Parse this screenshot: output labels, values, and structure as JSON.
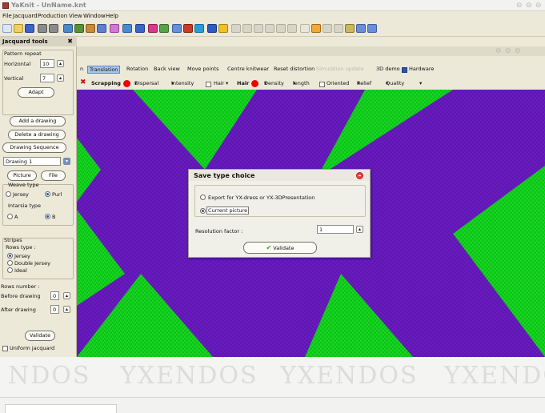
{
  "window": {
    "title": "YaKnit - UnName.knt"
  },
  "menu": [
    "File",
    "Jacquard",
    "Production",
    "View",
    "Window",
    "Help"
  ],
  "left_panel": {
    "title": "Jacquard tools",
    "pattern_repeat": {
      "label": "Pattern repeat",
      "horizontal_label": "Horizontal",
      "horizontal_value": "10",
      "vertical_label": "Vertical",
      "vertical_value": "7"
    },
    "adapt_label": "Adapt",
    "add_drawing_label": "Add a drawing",
    "delete_drawing_label": "Delete a drawing",
    "drawing_sequence_label": "Drawing Sequence",
    "drawing_select": "Drawing 1",
    "picture_label": "Picture",
    "file_label": "File",
    "weave_type": {
      "label": "Weave type",
      "options": [
        "Jersey",
        "Purl"
      ],
      "selected": 1
    },
    "intarsia_type": {
      "label": "Intarsia type",
      "options": [
        "A",
        "B"
      ],
      "selected": 1
    },
    "stripes": {
      "label": "Stripes",
      "rows_type_label": "Rows type :",
      "options": [
        "Jersey",
        "Double Jersey",
        "Ideal"
      ],
      "selected": 0
    },
    "rows_number": {
      "label": "Rows number :",
      "before_label": "Before drawing",
      "before_value": "0",
      "after_label": "After drawing",
      "after_value": "0"
    },
    "validate_label": "Validate",
    "uniform_label": "Uniform jacquard"
  },
  "view_toolbar": {
    "row1": [
      "n",
      "Translation",
      "Rotation",
      "Back view",
      "Move points",
      "Centre knitwear",
      "Reset distortion",
      "Simulation update",
      "3D demo"
    ],
    "hardware_label": "Hardware",
    "row2": {
      "scrapping": "Scrapping",
      "dispersal": "Dispersal",
      "intensity": "Intensity",
      "hair": "Hair",
      "hair_bold": "Hair",
      "density": "Density",
      "length": "length",
      "oriented": "Oriented",
      "relief": "Relief",
      "quality": "Quality"
    }
  },
  "dialog": {
    "title": "Save type choice",
    "option_export": "Export for YX-dress or YX-3DPresentation",
    "option_current": "Current picture",
    "resolution_label": "Resolution factor :",
    "resolution_value": "1",
    "validate_label": "Validate"
  },
  "watermark": [
    "NDOS",
    "YXENDOS",
    "YXENDOS",
    "YXENDO"
  ],
  "colors": {
    "purple": "#6a1bc4",
    "green": "#14d91f",
    "accent": "#3a62c2",
    "red": "#e00000"
  }
}
